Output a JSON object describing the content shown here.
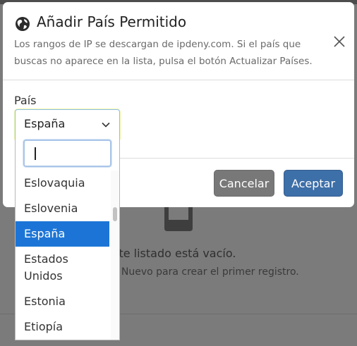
{
  "modal": {
    "title": "Añadir País Permitido",
    "description": "Los rangos de IP se descargan de ipdeny.com. Si el país que buscas no aparece en la lista, pulsa el botón Actualizar Países.",
    "field_label": "País",
    "selected_value": "España",
    "cancel_label": "Cancelar",
    "accept_label": "Aceptar"
  },
  "dropdown": {
    "search_value": "",
    "options": [
      {
        "label": "Eslovaquia",
        "selected": false
      },
      {
        "label": "Eslovenia",
        "selected": false
      },
      {
        "label": "España",
        "selected": true
      },
      {
        "label": "Estados Unidos",
        "selected": false
      },
      {
        "label": "Estonia",
        "selected": false
      },
      {
        "label": "Etiopía",
        "selected": false
      }
    ]
  },
  "background": {
    "empty_title": "Este listado está vacío.",
    "empty_hint": "on Nuevo para crear el primer registro."
  },
  "colors": {
    "accent": "#3d6fa8",
    "selected_option": "#1c75d6",
    "cancel": "#787878"
  },
  "icons": [
    "globe-icon",
    "close-icon",
    "chevron-down-icon",
    "inbox-tray-icon"
  ]
}
